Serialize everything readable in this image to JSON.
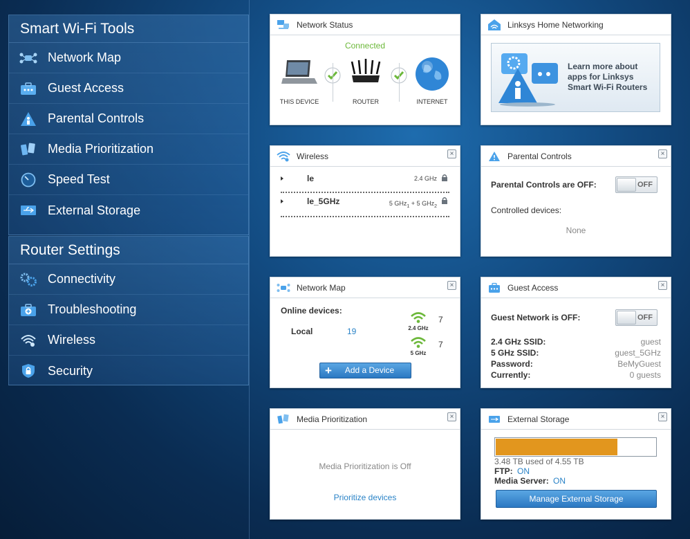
{
  "sidebar": {
    "tools_title": "Smart Wi-Fi Tools",
    "tools": [
      {
        "label": "Network Map",
        "icon": "network-map-icon"
      },
      {
        "label": "Guest Access",
        "icon": "guest-access-icon"
      },
      {
        "label": "Parental Controls",
        "icon": "parental-controls-icon"
      },
      {
        "label": "Media Prioritization",
        "icon": "media-prioritization-icon"
      },
      {
        "label": "Speed Test",
        "icon": "speed-test-icon"
      },
      {
        "label": "External Storage",
        "icon": "usb-icon"
      }
    ],
    "settings_title": "Router Settings",
    "settings": [
      {
        "label": "Connectivity",
        "icon": "gears-icon"
      },
      {
        "label": "Troubleshooting",
        "icon": "first-aid-icon"
      },
      {
        "label": "Wireless",
        "icon": "wifi-icon"
      },
      {
        "label": "Security",
        "icon": "shield-lock-icon"
      }
    ]
  },
  "network_status": {
    "title": "Network Status",
    "status": "Connected",
    "this_device": "THIS DEVICE",
    "router": "ROUTER",
    "internet": "INTERNET"
  },
  "linksys": {
    "title": "Linksys Home Networking",
    "promo_text": "Learn more about apps for Linksys Smart Wi-Fi Routers"
  },
  "wireless": {
    "title": "Wireless",
    "networks": [
      {
        "name": "le",
        "band": "2.4 GHz"
      },
      {
        "name": "le_5GHz",
        "band_a": "5 GHz",
        "sub_a": "1",
        "plus": "+",
        "band_b": "5 GHz",
        "sub_b": "2"
      }
    ]
  },
  "parental": {
    "title": "Parental Controls",
    "status_label": "Parental Controls are OFF:",
    "toggle": "OFF",
    "controlled_label": "Controlled devices:",
    "controlled_value": "None"
  },
  "network_map": {
    "title": "Network Map",
    "online_label": "Online devices:",
    "local_label": "Local",
    "local_count": "19",
    "band1_label": "2.4 GHz",
    "band1_count": "7",
    "band2_label": "5 GHz",
    "band2_count": "7",
    "add_button": "Add a Device",
    "add_symbol": "+"
  },
  "guest": {
    "title": "Guest Access",
    "status_label": "Guest Network is OFF:",
    "toggle": "OFF",
    "rows": [
      {
        "key": "2.4 GHz SSID:",
        "value": "guest"
      },
      {
        "key": "5 GHz SSID:",
        "value": "guest_5GHz"
      },
      {
        "key": "Password:",
        "value": "BeMyGuest"
      },
      {
        "key": "Currently:",
        "value": "0 guests"
      }
    ]
  },
  "media": {
    "title": "Media Prioritization",
    "status": "Media Prioritization is Off",
    "link": "Prioritize devices"
  },
  "storage": {
    "title": "External Storage",
    "used_fraction": 0.765,
    "bar_color": "#e2961e",
    "usage_text": "3.48 TB used of 4.55 TB",
    "ftp_label": "FTP:",
    "ftp_value": "ON",
    "media_label": "Media Server:",
    "media_value": "ON",
    "manage_button": "Manage External Storage"
  },
  "close_glyph": "×"
}
